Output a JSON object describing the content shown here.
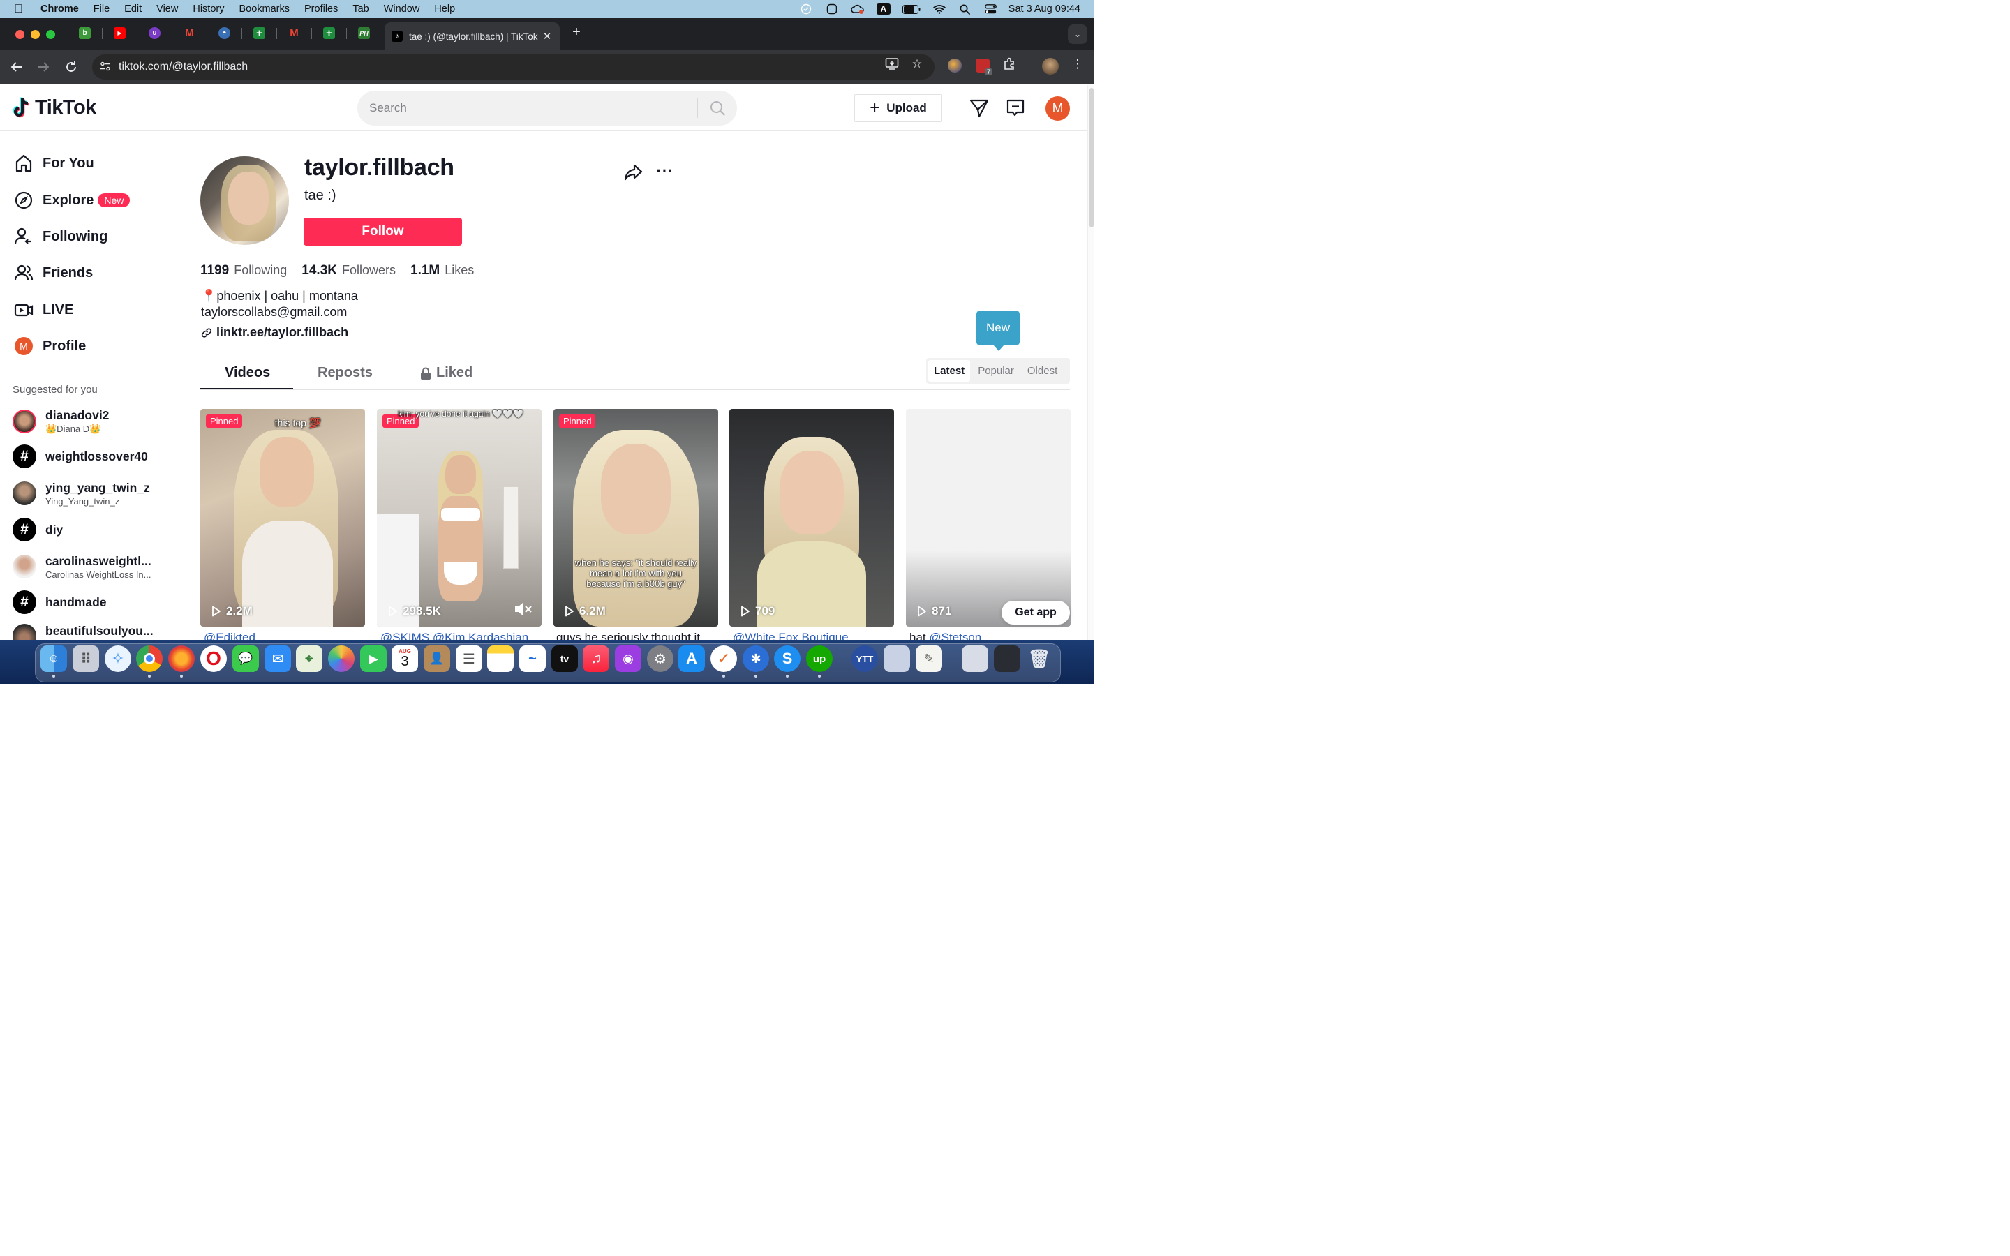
{
  "menubar": {
    "app": "Chrome",
    "items": [
      "File",
      "Edit",
      "View",
      "History",
      "Bookmarks",
      "Profiles",
      "Tab",
      "Window",
      "Help"
    ],
    "clock": "Sat 3 Aug  09:44",
    "input_source": "A"
  },
  "browser": {
    "active_tab_title": "tae :) (@taylor.fillbach) | TikTok",
    "url": "tiktok.com/@taylor.fillbach",
    "pinned_tabs": [
      {
        "icon": "b-icon",
        "glyph": "b",
        "color": "#3c9a3a"
      },
      {
        "icon": "youtube-icon",
        "glyph": "▶",
        "color": "#ff0000"
      },
      {
        "icon": "u-icon",
        "glyph": "u",
        "color": "#7a3cc4"
      },
      {
        "icon": "gmail-icon",
        "glyph": "M",
        "color": "#c5221f"
      },
      {
        "icon": "globe-icon",
        "glyph": "◓",
        "color": "#3a6fb4"
      },
      {
        "icon": "sheets-icon",
        "glyph": "+",
        "color": "#1e8e3e"
      },
      {
        "icon": "gmail-icon",
        "glyph": "M",
        "color": "#c5221f"
      },
      {
        "icon": "sheets-icon",
        "glyph": "+",
        "color": "#1e8e3e"
      },
      {
        "icon": "ph-icon",
        "glyph": "PH",
        "color": "#2e7d32"
      }
    ],
    "extension_badge": "7"
  },
  "tiktok": {
    "logo": "TikTok",
    "search_placeholder": "Search",
    "upload_label": "Upload",
    "user_initial": "M"
  },
  "sidebar": {
    "nav": [
      {
        "label": "For You",
        "icon": "home-icon"
      },
      {
        "label": "Explore",
        "icon": "compass-icon",
        "badge": "New"
      },
      {
        "label": "Following",
        "icon": "following-icon"
      },
      {
        "label": "Friends",
        "icon": "friends-icon"
      },
      {
        "label": "LIVE",
        "icon": "live-icon"
      },
      {
        "label": "Profile",
        "icon": "profile-avatar",
        "initial": "M"
      }
    ],
    "suggested_title": "Suggested for you",
    "suggested": [
      {
        "name": "dianadovi2",
        "sub": "👑Diana D👑",
        "type": "user"
      },
      {
        "name": "weightlossover40",
        "type": "hashtag"
      },
      {
        "name": "ying_yang_twin_z",
        "sub": "Ying_Yang_twin_z",
        "type": "user"
      },
      {
        "name": "diy",
        "type": "hashtag"
      },
      {
        "name": "carolinasweightl...",
        "sub": "Carolinas WeightLoss In...",
        "type": "user"
      },
      {
        "name": "handmade",
        "type": "hashtag"
      },
      {
        "name": "beautifulsoulyou...",
        "type": "user"
      }
    ]
  },
  "profile": {
    "username": "taylor.fillbach",
    "nickname": "tae :)",
    "follow_label": "Follow",
    "stats": [
      {
        "value": "1199",
        "label": "Following"
      },
      {
        "value": "14.3K",
        "label": "Followers"
      },
      {
        "value": "1.1M",
        "label": "Likes"
      }
    ],
    "bio_line1": "📍phoenix | oahu | montana",
    "bio_line2": "taylorscollabs@gmail.com",
    "link": "linktr.ee/taylor.fillbach"
  },
  "tabs": {
    "videos": "Videos",
    "reposts": "Reposts",
    "liked": "Liked",
    "tooltip": "New",
    "sort": [
      "Latest",
      "Popular",
      "Oldest"
    ],
    "sort_selected": "Latest"
  },
  "videos": [
    {
      "pinned": "Pinned",
      "views": "2.2M",
      "overlay": "this top 💯",
      "caption_mention": "@Edikted",
      "caption_text": ""
    },
    {
      "pinned": "Pinned",
      "views": "298.5K",
      "overlay": "kim: you've done it again 🤍🤍🤍",
      "caption_mention": "@SKIMS @Kim Kardashian",
      "caption_text": "",
      "muted": true
    },
    {
      "pinned": "Pinned",
      "views": "6.2M",
      "overlay": "when he says: \"it should really mean a lot i'm with you because i'm a b00b guy\"",
      "caption_mention": "",
      "caption_text": "guys he seriously thought it"
    },
    {
      "views": "709",
      "caption_mention": "@White Fox Boutique",
      "caption_text": ""
    },
    {
      "views": "871",
      "caption_text": "hat ",
      "caption_mention": "@Stetson"
    }
  ],
  "get_app": "Get app",
  "dock": {
    "calendar_month": "AUG",
    "calendar_day": "3"
  }
}
